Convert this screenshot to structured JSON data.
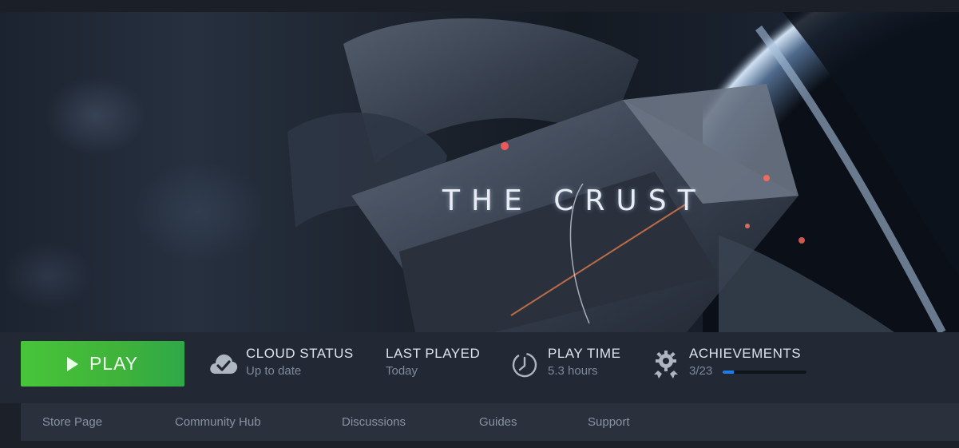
{
  "hero": {
    "logo": "THE CRUST"
  },
  "play": {
    "label": "PLAY"
  },
  "stats": {
    "cloud": {
      "title": "CLOUD STATUS",
      "value": "Up to date",
      "icon": "cloud-check-icon"
    },
    "last_played": {
      "title": "LAST PLAYED",
      "value": "Today"
    },
    "play_time": {
      "title": "PLAY TIME",
      "value": "5.3 hours",
      "icon": "clock-icon"
    },
    "achievements": {
      "title": "ACHIEVEMENTS",
      "value": "3/23",
      "icon": "achievement-gear-icon",
      "unlocked": 3,
      "total": 23
    }
  },
  "tabs": [
    {
      "label": "Store Page"
    },
    {
      "label": "Community Hub"
    },
    {
      "label": "Discussions"
    },
    {
      "label": "Guides"
    },
    {
      "label": "Support"
    }
  ],
  "colors": {
    "play_green": "#48c53a",
    "progress_blue": "#1e7ce8",
    "background": "#1b2029"
  }
}
